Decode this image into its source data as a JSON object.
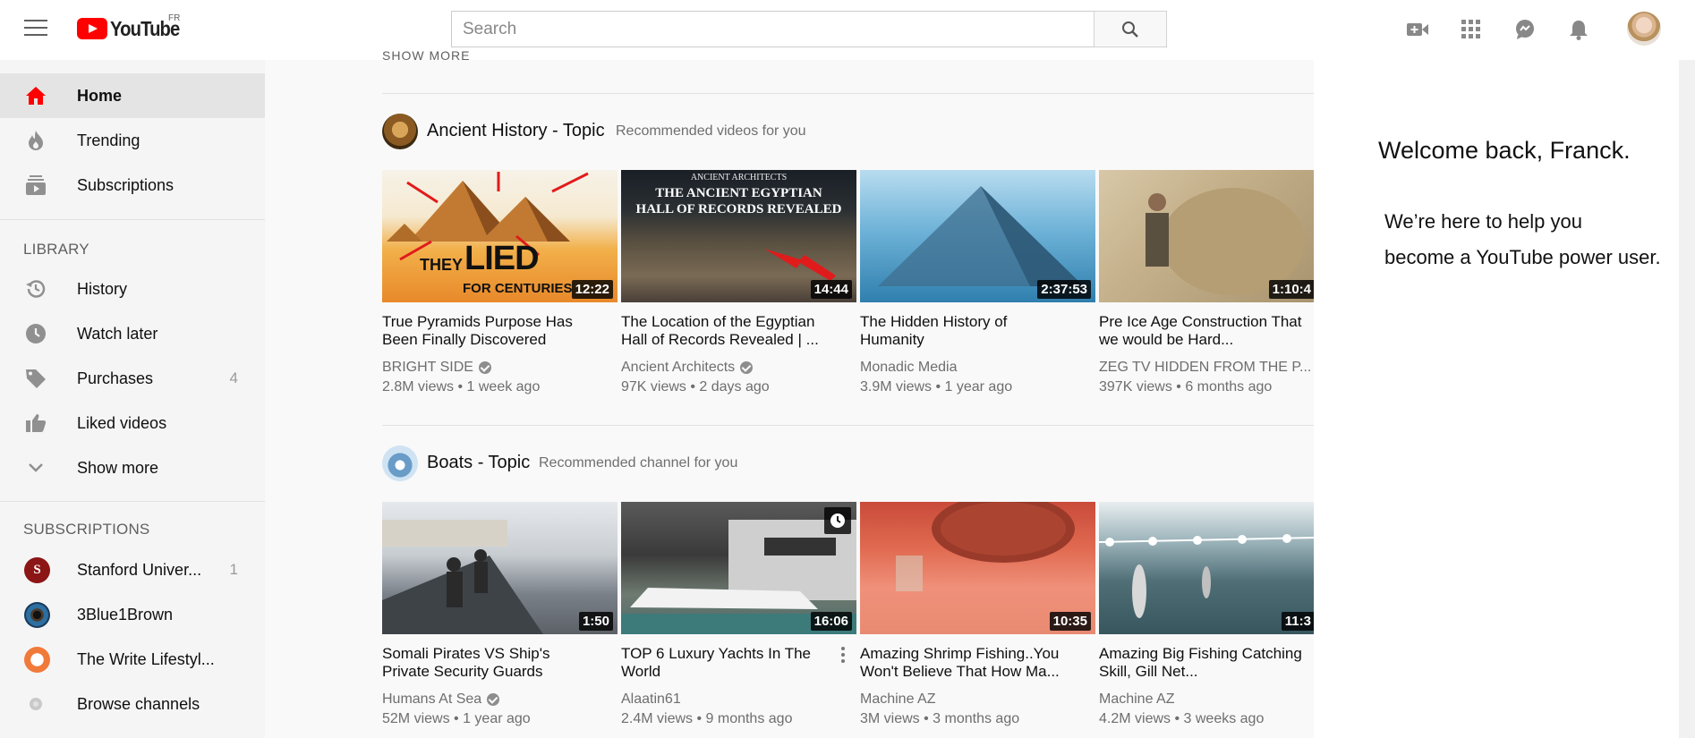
{
  "header": {
    "logo_text": "YouTube",
    "region": "FR",
    "search_placeholder": "Search"
  },
  "sidebar": {
    "main_items": [
      {
        "label": "Home",
        "icon": "home-icon",
        "active": true
      },
      {
        "label": "Trending",
        "icon": "flame-icon"
      },
      {
        "label": "Subscriptions",
        "icon": "subscriptions-icon"
      }
    ],
    "library_heading": "LIBRARY",
    "library_items": [
      {
        "label": "History",
        "icon": "history-icon",
        "count": ""
      },
      {
        "label": "Watch later",
        "icon": "clock-icon",
        "count": ""
      },
      {
        "label": "Purchases",
        "icon": "tag-icon",
        "count": "4"
      },
      {
        "label": "Liked videos",
        "icon": "thumbs-up-icon",
        "count": ""
      },
      {
        "label": "Show more",
        "icon": "chevron-down-icon",
        "count": ""
      }
    ],
    "subscriptions_heading": "SUBSCRIPTIONS",
    "subscriptions": [
      {
        "label": "Stanford Univer...",
        "count": "1",
        "color": "#8c1515"
      },
      {
        "label": "3Blue1Brown",
        "count": "",
        "color": "#1a3a5c"
      },
      {
        "label": "The Write Lifestyl...",
        "count": "",
        "color": "#f07a3a"
      },
      {
        "label": "Browse channels",
        "count": "",
        "color": "#c9c9c9"
      }
    ]
  },
  "main": {
    "top_link": "SHOW MORE",
    "shelves": [
      {
        "title": "Ancient History - Topic",
        "subtitle": "Recommended videos for you",
        "videos": [
          {
            "title": "True Pyramids Purpose Has Been Finally Discovered",
            "channel": "BRIGHT SIDE",
            "verified": true,
            "meta": "2.8M views • 1 week ago",
            "duration": "12:22",
            "thumb_text_1": "THEY",
            "thumb_text_2": "LIED",
            "thumb_text_3": "FOR CENTURIES"
          },
          {
            "title": "The Location of the Egyptian Hall of Records Revealed | ...",
            "channel": "Ancient Architects",
            "verified": true,
            "meta": "97K views • 2 days ago",
            "duration": "14:44",
            "thumb_text_1": "ANCIENT ARCHITECTS",
            "thumb_text_2": "THE ANCIENT EGYPTIAN",
            "thumb_text_3": "HALL OF RECORDS REVEALED"
          },
          {
            "title": "The Hidden History of Humanity",
            "channel": "Monadic Media",
            "verified": false,
            "meta": "3.9M views • 1 year ago",
            "duration": "2:37:53"
          },
          {
            "title": "Pre Ice Age Construction That we would be Hard...",
            "channel": "ZEG TV HIDDEN FROM THE P...",
            "verified": false,
            "meta": "397K views • 6 months ago",
            "duration": "1:10:4"
          }
        ]
      },
      {
        "title": "Boats - Topic",
        "subtitle": "Recommended channel for you",
        "videos": [
          {
            "title": "Somali Pirates VS Ship's Private Security Guards",
            "channel": "Humans At Sea",
            "verified": true,
            "meta": "52M views • 1 year ago",
            "duration": "1:50"
          },
          {
            "title": "TOP 6 Luxury Yachts In The World",
            "channel": "Alaatin61",
            "verified": false,
            "meta": "2.4M views • 9 months ago",
            "duration": "16:06"
          },
          {
            "title": "Amazing Shrimp Fishing..You Won't Believe That How Ma...",
            "channel": "Machine AZ",
            "verified": false,
            "meta": "3M views • 3 months ago",
            "duration": "10:35"
          },
          {
            "title": "Amazing Big Fishing Catching Skill, Gill Net...",
            "channel": "Machine AZ",
            "verified": false,
            "meta": "4.2M views • 3 weeks ago",
            "duration": "11:3"
          }
        ]
      }
    ]
  },
  "welcome": {
    "title": "Welcome back, Franck.",
    "line1": "We’re here to help you",
    "line2": "become a YouTube power user."
  },
  "colors": {
    "brand": "#ff0000",
    "sidebar_bg": "#f5f5f5",
    "active_bg": "#e4e4e4"
  }
}
